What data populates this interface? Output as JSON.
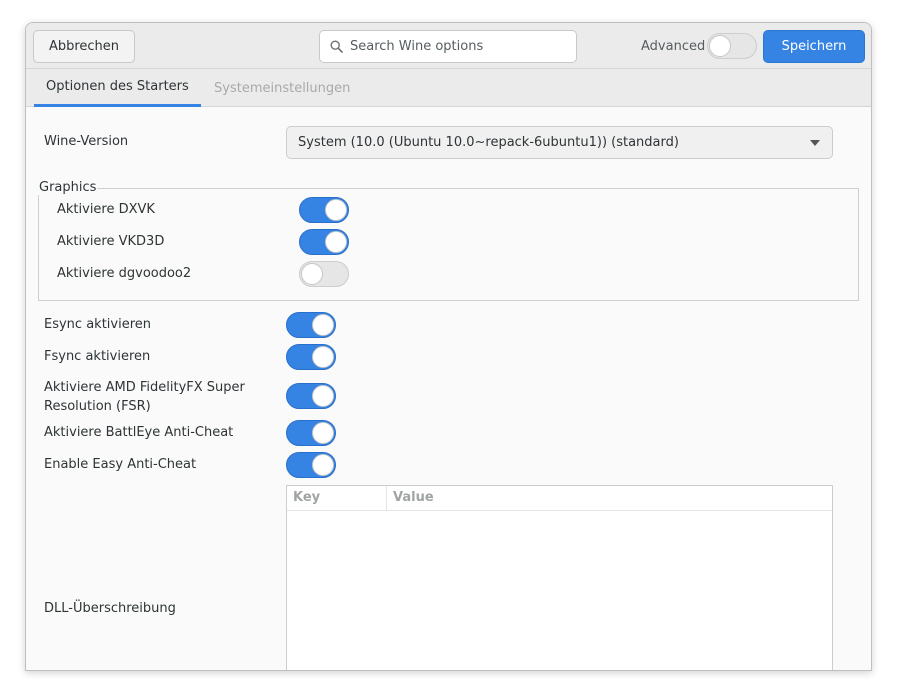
{
  "header": {
    "cancel_label": "Abbrechen",
    "search_placeholder": "Search Wine options",
    "advanced_label": "Advanced",
    "advanced_on": false,
    "save_label": "Speichern"
  },
  "tabs": [
    {
      "label": "Optionen des Starters",
      "active": true
    },
    {
      "label": "Systemeinstellungen",
      "active": false
    }
  ],
  "wine_version": {
    "label": "Wine-Version",
    "value": "System (10.0 (Ubuntu 10.0~repack-6ubuntu1)) (standard)"
  },
  "graphics": {
    "title": "Graphics",
    "options": [
      {
        "label": "Aktiviere DXVK",
        "on": true
      },
      {
        "label": "Aktiviere VKD3D",
        "on": true
      },
      {
        "label": "Aktiviere dgvoodoo2",
        "on": false
      }
    ]
  },
  "options": [
    {
      "label": "Esync aktivieren",
      "on": true
    },
    {
      "label": "Fsync aktivieren",
      "on": true
    },
    {
      "label": "Aktiviere AMD FidelityFX Super Resolution (FSR)",
      "on": true
    },
    {
      "label": "Aktiviere BattlEye Anti-Cheat",
      "on": true
    },
    {
      "label": "Enable Easy Anti-Cheat",
      "on": true
    }
  ],
  "dll": {
    "label": "DLL-Überschreibung",
    "columns": [
      "Key",
      "Value"
    ]
  },
  "colors": {
    "accent": "#3584e4",
    "header_bg": "#ebebeb",
    "content_bg": "#fafafa"
  }
}
